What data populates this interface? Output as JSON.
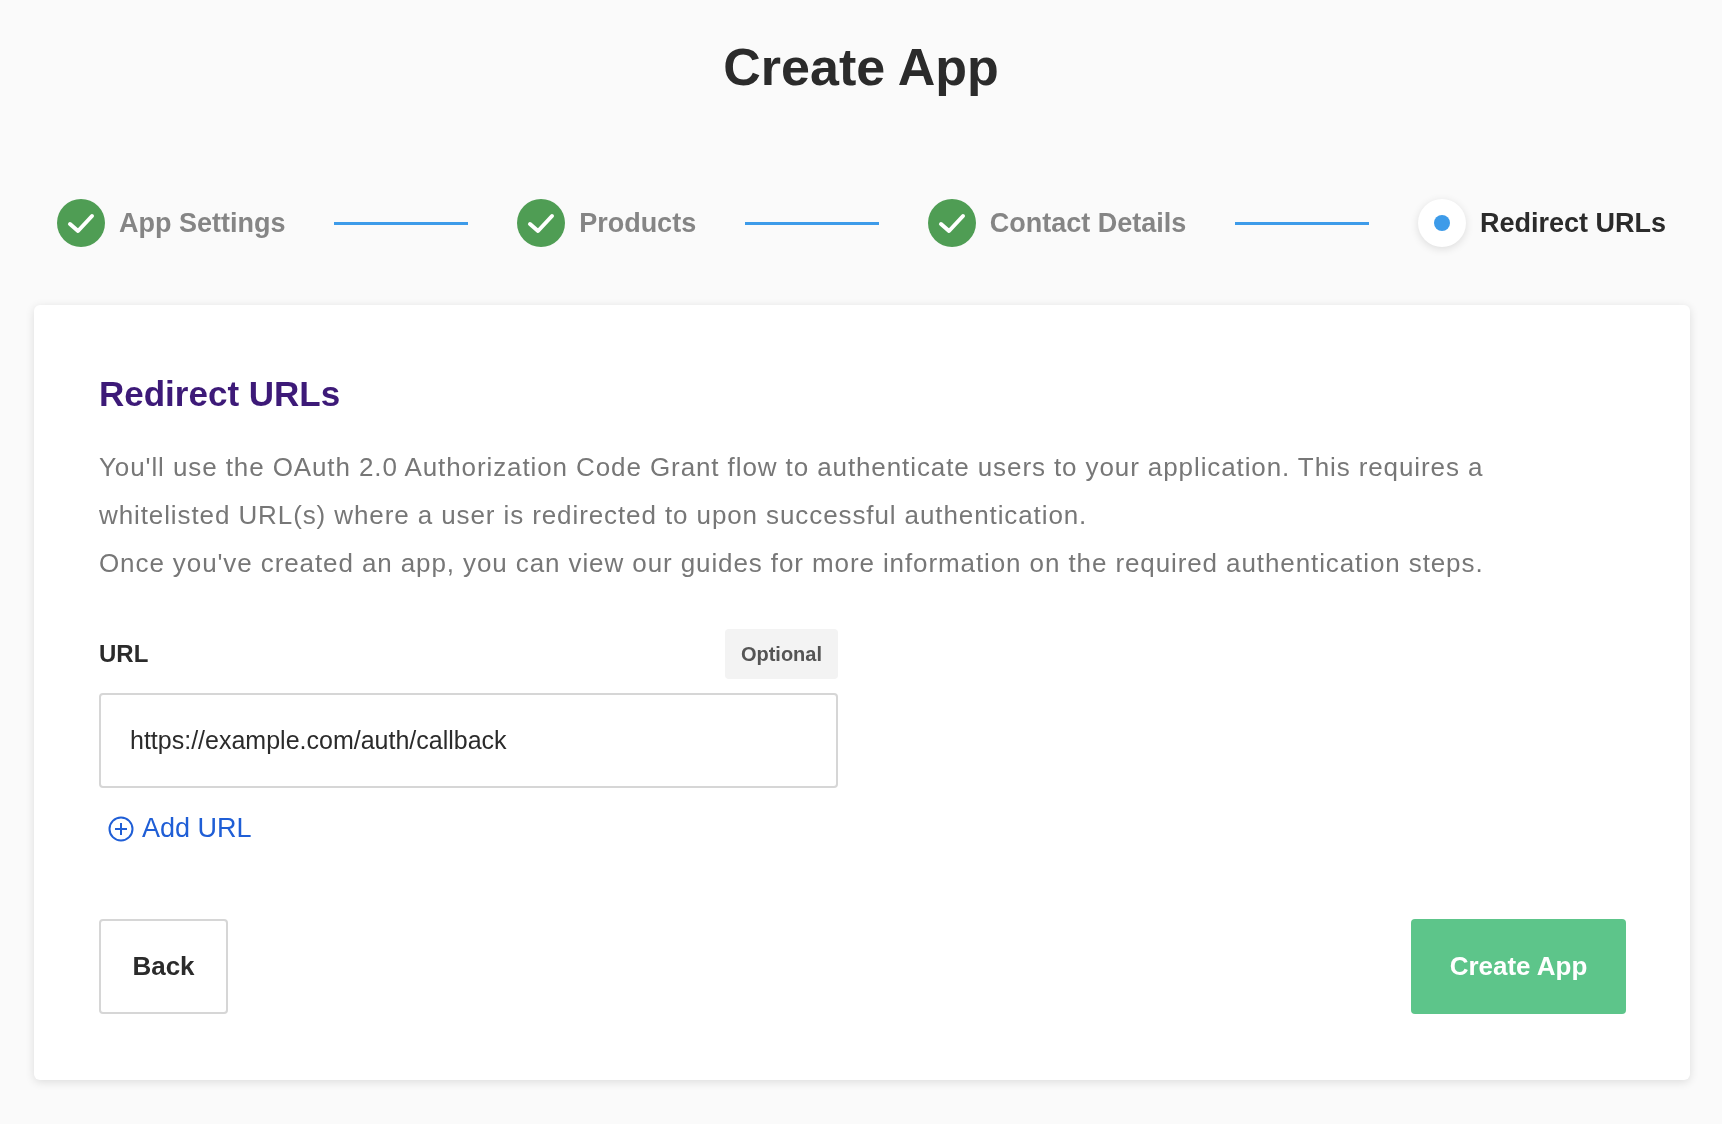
{
  "title": "Create App",
  "steps": [
    {
      "label": "App Settings",
      "completed": true
    },
    {
      "label": "Products",
      "completed": true
    },
    {
      "label": "Contact Details",
      "completed": true
    },
    {
      "label": "Redirect URLs",
      "completed": false
    }
  ],
  "card": {
    "heading": "Redirect URLs",
    "paragraphs": [
      "You'll use the OAuth 2.0 Authorization Code Grant flow to authenticate users to your application. This requires a whitelisted URL(s) where a user is redirected to upon successful authentication.",
      "Once you've created an app, you can view our guides for more information on the required authentication steps."
    ],
    "url_field": {
      "label": "URL",
      "badge": "Optional",
      "value": "https://example.com/auth/callback"
    },
    "add_url": "Add URL",
    "back_button": "Back",
    "create_button": "Create App"
  }
}
